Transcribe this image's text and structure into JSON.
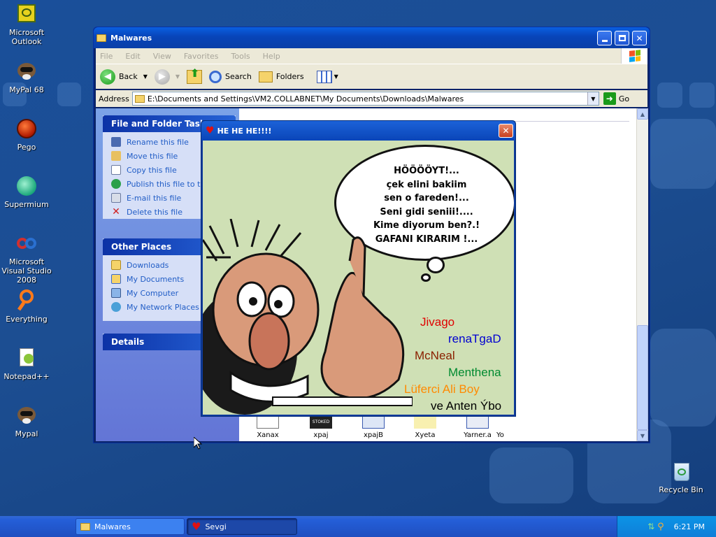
{
  "desktop": {
    "icons": [
      {
        "label": "Microsoft Outlook",
        "icon": "outlook-icon"
      },
      {
        "label": "MyPal 68",
        "icon": "mypal-icon"
      },
      {
        "label": "Pego",
        "icon": "pego-icon"
      },
      {
        "label": "Supermium",
        "icon": "supermium-icon"
      },
      {
        "label": "Microsoft Visual Studio 2008",
        "icon": "visual-studio-icon"
      },
      {
        "label": "Everything",
        "icon": "everything-icon"
      },
      {
        "label": "Notepad++",
        "icon": "notepadpp-icon"
      },
      {
        "label": "Mypal",
        "icon": "mypal-icon"
      }
    ],
    "recycle_bin": {
      "label": "Recycle Bin",
      "icon": "recycle-bin-icon"
    }
  },
  "explorer": {
    "title": "Malwares",
    "menu": [
      "File",
      "Edit",
      "View",
      "Favorites",
      "Tools",
      "Help"
    ],
    "toolbar": {
      "back": "Back",
      "search": "Search",
      "folders": "Folders"
    },
    "address": {
      "label": "Address",
      "value": "E:\\Documents and Settings\\VM2.COLLABNET\\My Documents\\Downloads\\Malwares",
      "go": "Go"
    },
    "tasks": {
      "title": "File and Folder Tasks",
      "items": [
        "Rename this file",
        "Move this file",
        "Copy this file",
        "Publish this file to the Web",
        "E-mail this file",
        "Delete this file"
      ]
    },
    "places": {
      "title": "Other Places",
      "items": [
        "Downloads",
        "My Documents",
        "My Computer",
        "My Network Places"
      ]
    },
    "details": {
      "title": "Details"
    },
    "files": [
      "Xanax",
      "xpaj",
      "xpajB",
      "Xyeta",
      "Yarner.a",
      "Yo"
    ]
  },
  "popup": {
    "title": "HE HE HE!!!!",
    "speech": [
      "HÖÖÖÖYT!...",
      "çek elini bakiim",
      "sen o fareden!...",
      "Seni gidi seniii!....",
      "Kime diyorum ben?.!",
      "GAFANI KIRARIM !..."
    ],
    "names": [
      {
        "text": "Jivago",
        "color": "#e00000"
      },
      {
        "text": "renaTgaD",
        "color": "#0000d0"
      },
      {
        "text": "McNeal",
        "color": "#8a2000"
      },
      {
        "text": "Menthena",
        "color": "#008a30"
      },
      {
        "text": "Lüferci Ali Boy",
        "color": "#ff8a00"
      },
      {
        "text": "ve Anten Ýbo",
        "color": "#000000"
      }
    ]
  },
  "taskbar": {
    "buttons": [
      {
        "label": "Malwares",
        "icon": "folder-icon"
      },
      {
        "label": "Sevgi",
        "icon": "heart-icon"
      }
    ],
    "clock": "6:21 PM"
  },
  "colors": {
    "desktop": "#1c4e92",
    "taskbar": "#245ed8",
    "titlebar": "#0a5fe0",
    "task_link": "#215dc6"
  }
}
